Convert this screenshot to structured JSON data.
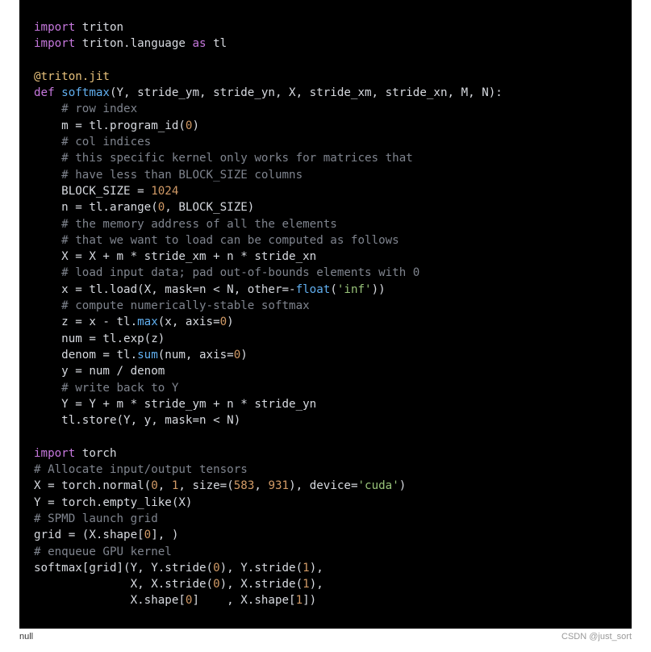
{
  "code": {
    "lines": [
      [
        [
          "kw",
          "import"
        ],
        [
          "default",
          " triton"
        ]
      ],
      [
        [
          "kw",
          "import"
        ],
        [
          "default",
          " triton.language "
        ],
        [
          "kw",
          "as"
        ],
        [
          "default",
          " tl"
        ]
      ],
      [],
      [
        [
          "dec",
          "@triton.jit"
        ]
      ],
      [
        [
          "kw",
          "def "
        ],
        [
          "fn",
          "softmax"
        ],
        [
          "default",
          "(Y, stride_ym, stride_yn, X, stride_xm, stride_xn, M, N):"
        ]
      ],
      [
        [
          "default",
          "    "
        ],
        [
          "comment",
          "# row index"
        ]
      ],
      [
        [
          "default",
          "    m = tl.program_id("
        ],
        [
          "num",
          "0"
        ],
        [
          "default",
          ")"
        ]
      ],
      [
        [
          "default",
          "    "
        ],
        [
          "comment",
          "# col indices"
        ]
      ],
      [
        [
          "default",
          "    "
        ],
        [
          "comment",
          "# this specific kernel only works for matrices that"
        ]
      ],
      [
        [
          "default",
          "    "
        ],
        [
          "comment",
          "# have less than BLOCK_SIZE columns"
        ]
      ],
      [
        [
          "default",
          "    BLOCK_SIZE = "
        ],
        [
          "num",
          "1024"
        ]
      ],
      [
        [
          "default",
          "    n = tl.arange("
        ],
        [
          "num",
          "0"
        ],
        [
          "default",
          ", BLOCK_SIZE)"
        ]
      ],
      [
        [
          "default",
          "    "
        ],
        [
          "comment",
          "# the memory address of all the elements"
        ]
      ],
      [
        [
          "default",
          "    "
        ],
        [
          "comment",
          "# that we want to load can be computed as follows"
        ]
      ],
      [
        [
          "default",
          "    X = X + m * stride_xm + n * stride_xn"
        ]
      ],
      [
        [
          "default",
          "    "
        ],
        [
          "comment",
          "# load input data; pad out-of-bounds elements with 0"
        ]
      ],
      [
        [
          "default",
          "    x = tl.load(X, mask=n < N, other=-"
        ],
        [
          "fn",
          "float"
        ],
        [
          "default",
          "("
        ],
        [
          "str",
          "'inf'"
        ],
        [
          "default",
          "))"
        ]
      ],
      [
        [
          "default",
          "    "
        ],
        [
          "comment",
          "# compute numerically-stable softmax"
        ]
      ],
      [
        [
          "default",
          "    z = x - tl."
        ],
        [
          "call",
          "max"
        ],
        [
          "default",
          "(x, axis="
        ],
        [
          "num",
          "0"
        ],
        [
          "default",
          ")"
        ]
      ],
      [
        [
          "default",
          "    num = tl.exp(z)"
        ]
      ],
      [
        [
          "default",
          "    denom = tl."
        ],
        [
          "call",
          "sum"
        ],
        [
          "default",
          "(num, axis="
        ],
        [
          "num",
          "0"
        ],
        [
          "default",
          ")"
        ]
      ],
      [
        [
          "default",
          "    y = num / denom"
        ]
      ],
      [
        [
          "default",
          "    "
        ],
        [
          "comment",
          "# write back to Y"
        ]
      ],
      [
        [
          "default",
          "    Y = Y + m * stride_ym + n * stride_yn"
        ]
      ],
      [
        [
          "default",
          "    tl.store(Y, y, mask=n < N)"
        ]
      ],
      [],
      [
        [
          "kw",
          "import"
        ],
        [
          "default",
          " torch"
        ]
      ],
      [
        [
          "comment",
          "# Allocate input/output tensors"
        ]
      ],
      [
        [
          "default",
          "X = torch.normal("
        ],
        [
          "num",
          "0"
        ],
        [
          "default",
          ", "
        ],
        [
          "num",
          "1"
        ],
        [
          "default",
          ", size=("
        ],
        [
          "num",
          "583"
        ],
        [
          "default",
          ", "
        ],
        [
          "num",
          "931"
        ],
        [
          "default",
          "), device="
        ],
        [
          "str",
          "'cuda'"
        ],
        [
          "default",
          ")"
        ]
      ],
      [
        [
          "default",
          "Y = torch.empty_like(X)"
        ]
      ],
      [
        [
          "comment",
          "# SPMD launch grid"
        ]
      ],
      [
        [
          "default",
          "grid = (X.shape["
        ],
        [
          "num",
          "0"
        ],
        [
          "default",
          "], )"
        ]
      ],
      [
        [
          "comment",
          "# enqueue GPU kernel"
        ]
      ],
      [
        [
          "default",
          "softmax[grid](Y, Y.stride("
        ],
        [
          "num",
          "0"
        ],
        [
          "default",
          "), Y.stride("
        ],
        [
          "num",
          "1"
        ],
        [
          "default",
          "),"
        ]
      ],
      [
        [
          "default",
          "              X, X.stride("
        ],
        [
          "num",
          "0"
        ],
        [
          "default",
          "), X.stride("
        ],
        [
          "num",
          "1"
        ],
        [
          "default",
          "),"
        ]
      ],
      [
        [
          "default",
          "              X.shape["
        ],
        [
          "num",
          "0"
        ],
        [
          "default",
          "]    , X.shape["
        ],
        [
          "num",
          "1"
        ],
        [
          "default",
          "])"
        ]
      ]
    ]
  },
  "caption": {
    "left": "null",
    "right": "CSDN @just_sort"
  }
}
